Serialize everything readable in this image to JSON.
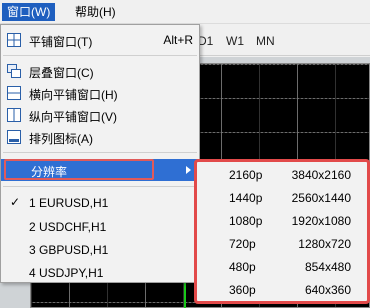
{
  "menubar": {
    "window": "窗口(W)",
    "help": "帮助(H)"
  },
  "toolbar": {
    "d1_fragment": "D1",
    "w1": "W1",
    "mn": "MN"
  },
  "menu": {
    "tile": {
      "label": "平铺窗口(T)",
      "shortcut": "Alt+R"
    },
    "cascade": {
      "label": "层叠窗口(C)"
    },
    "tile_horizontal": {
      "label": "横向平铺窗口(H)"
    },
    "tile_vertical": {
      "label": "纵向平铺窗口(V)"
    },
    "arrange_icons": {
      "label": "排列图标(A)"
    },
    "resolution": {
      "label": "分辨率"
    },
    "windows": [
      {
        "label": "1 EURUSD,H1",
        "checked": true
      },
      {
        "label": "2 USDCHF,H1",
        "checked": false
      },
      {
        "label": "3 GBPUSD,H1",
        "checked": false
      },
      {
        "label": "4 USDJPY,H1",
        "checked": false
      }
    ]
  },
  "submenu": {
    "items": [
      {
        "name": "2160p",
        "size": "3840x2160"
      },
      {
        "name": "1440p",
        "size": "2560x1440"
      },
      {
        "name": "1080p",
        "size": "1920x1080"
      },
      {
        "name": "720p",
        "size": "1280x720"
      },
      {
        "name": "480p",
        "size": "854x480"
      },
      {
        "name": "360p",
        "size": "640x360"
      }
    ]
  },
  "colors": {
    "menu_highlight": "#2f6fd3",
    "annotation_red": "#e24a4a",
    "chart_bg": "#000000",
    "chart_accent_green": "#18c818"
  },
  "check_mark": "✓"
}
